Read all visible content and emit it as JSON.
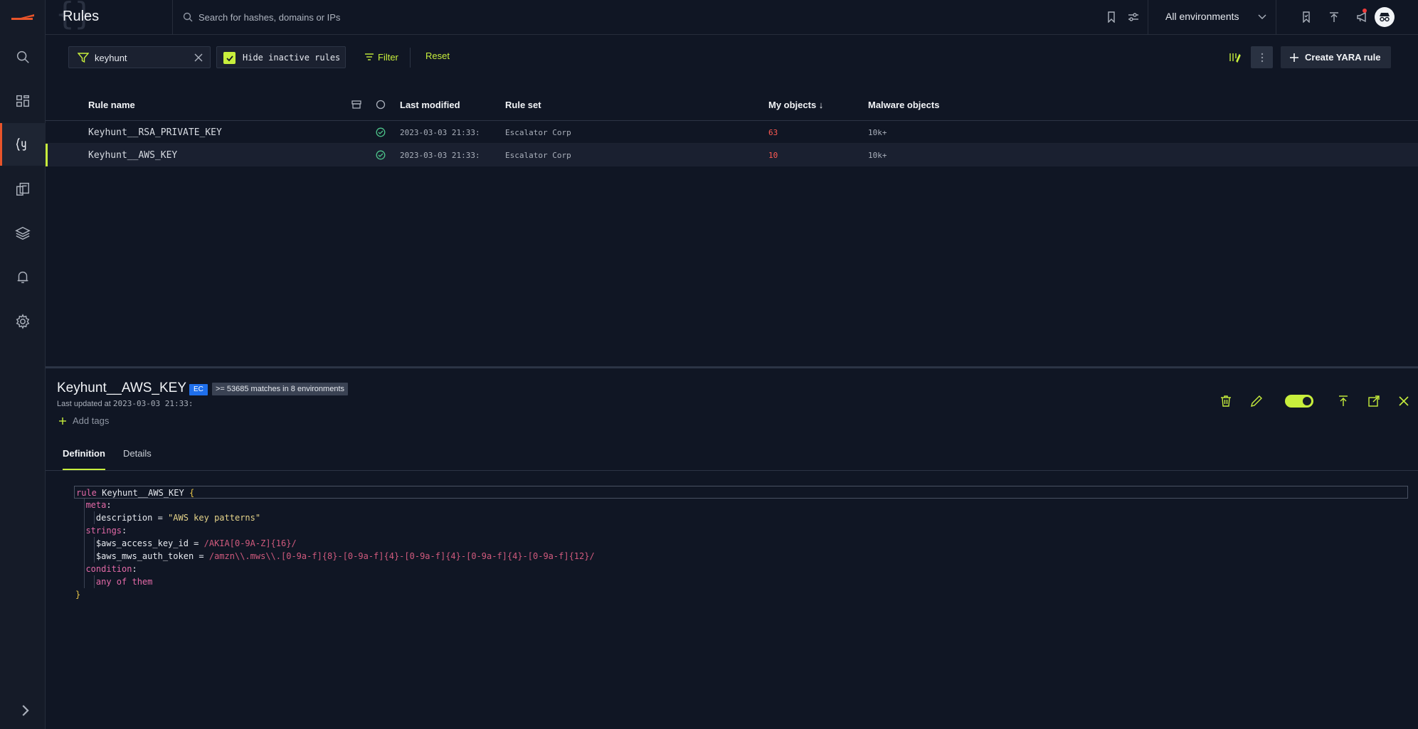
{
  "app": {
    "page_title": "Rules"
  },
  "topbar": {
    "search_placeholder": "Search for hashes, domains or IPs",
    "environment": "All environments"
  },
  "toolbar": {
    "filter_value": "keyhunt",
    "hide_inactive_label": "Hide inactive rules",
    "filter_label": "Filter",
    "reset_label": "Reset",
    "create_label": "Create YARA rule"
  },
  "table": {
    "columns": {
      "rule_name": "Rule name",
      "last_modified": "Last modified",
      "rule_set": "Rule set",
      "my_objects": "My objects ↓",
      "malware_objects": "Malware objects"
    },
    "rows": [
      {
        "name": "Keyhunt__RSA_PRIVATE_KEY",
        "modified": "2023-03-03 21:33:",
        "rule_set": "Escalator Corp",
        "my_objects": "63",
        "malware_objects": "10k+",
        "selected": false
      },
      {
        "name": "Keyhunt__AWS_KEY",
        "modified": "2023-03-03 21:33:",
        "rule_set": "Escalator Corp",
        "my_objects": "10",
        "malware_objects": "10k+",
        "selected": true
      }
    ]
  },
  "detail": {
    "title": "Keyhunt__AWS_KEY",
    "badge": "EC",
    "matches": ">= 53685 matches in 8 environments",
    "updated_prefix": "Last updated at",
    "updated_value": "2023-03-03 21:33:",
    "add_tags": "Add tags",
    "tabs": [
      "Definition",
      "Details"
    ],
    "code": {
      "l1_kw": "rule",
      "l1_name": " Keyhunt__AWS_KEY ",
      "l1_brace": "{",
      "meta": "meta",
      "desc_key": "description = ",
      "desc_val": "\"AWS key patterns\"",
      "strings": "strings",
      "s1_key": "$aws_access_key_id = ",
      "s1_val": "/AKIA[0-9A-Z]{16}/",
      "s2_key": "$aws_mws_auth_token = ",
      "s2_val": "/amzn\\\\.mws\\\\.[0-9a-f]{8}-[0-9a-f]{4}-[0-9a-f]{4}-[0-9a-f]{4}-[0-9a-f]{12}/",
      "condition": "condition",
      "cond_val": "any of them",
      "close": "}"
    }
  },
  "colors": {
    "accent": "#c8ef3c",
    "brand": "#e8542a",
    "danger": "#ff5a52",
    "badge_blue": "#1f6feb"
  }
}
